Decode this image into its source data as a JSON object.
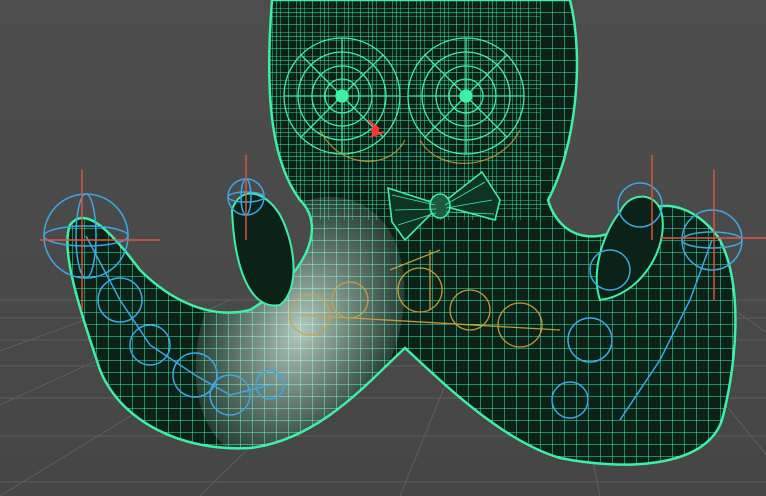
{
  "viewport": {
    "view": "perspective-viewport",
    "display_mode": "wireframe",
    "colors": {
      "background": "#4a4a4a",
      "grid": "#5e5e5e",
      "mesh_wire": "#3cf0a6",
      "mesh_fill": "#0c2219",
      "skin_highlight": "#eafff6",
      "joint": "#3aa9e8",
      "selected_joint": "#ff3333",
      "skin_weight": "#d2a43a",
      "locator": "#e0563e"
    }
  },
  "scene": {
    "object": "octopus-mesh",
    "accessory": "bow-tie-mesh",
    "joint_chains": [
      "front-left-tentacle-chain",
      "front-right-tentacle-chain",
      "center-chain"
    ],
    "handles": [
      "far-left-locator",
      "back-left-locator",
      "back-right-locator",
      "far-right-locator"
    ]
  }
}
